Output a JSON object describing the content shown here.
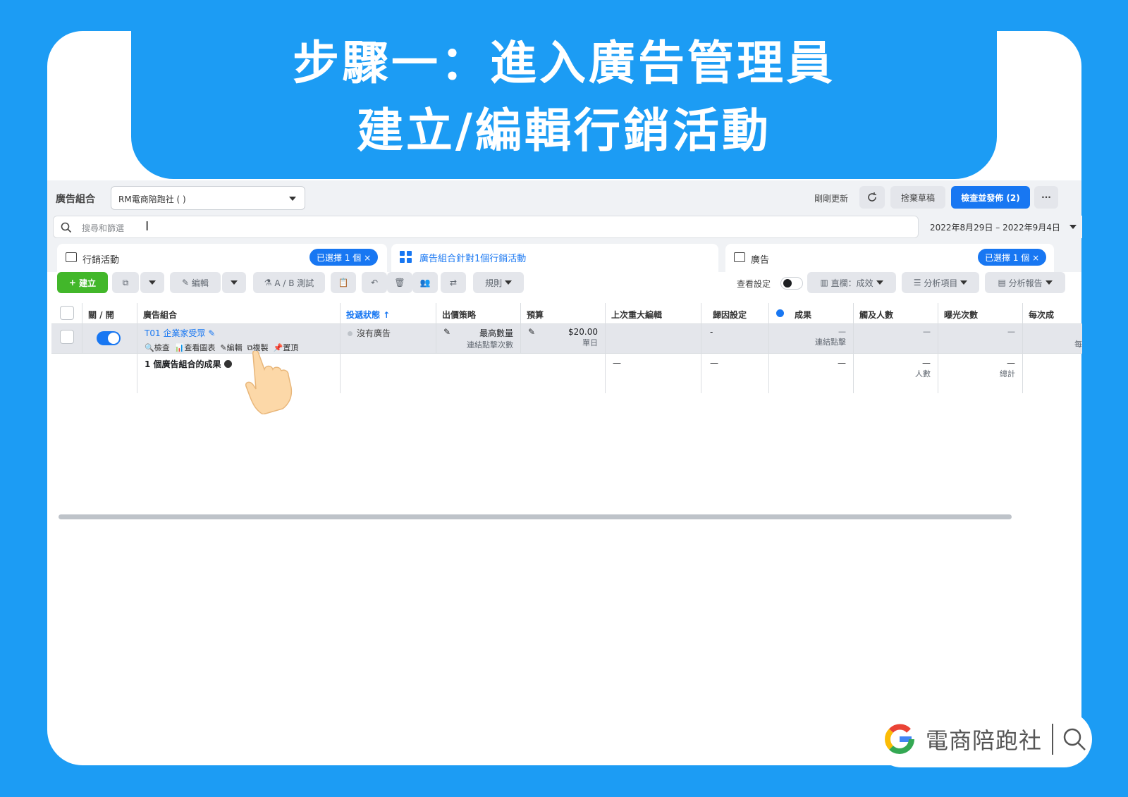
{
  "banner": {
    "line1": "步驟一：進入廣告管理員",
    "line2": "建立/編輯行銷活動"
  },
  "topbar": {
    "section_label": "廣告組合",
    "account_value": "RM電商陪跑社 (                    )",
    "refreshed": "剛剛更新",
    "discard": "捨棄草稿",
    "publish": "檢查並發佈 (2)",
    "more": "···"
  },
  "search": {
    "placeholder": "搜尋和篩選",
    "date_range": "2022年8月29日 – 2022年9月4日"
  },
  "tabs": [
    {
      "label": "行銷活動",
      "chip": "已選擇 1 個"
    },
    {
      "label": "廣告組合針對1個行銷活動"
    },
    {
      "label": "廣告",
      "chip": "已選擇 1 個"
    }
  ],
  "toolbar": {
    "create": "建立",
    "edit": "編輯",
    "ab_test": "A / B 測試",
    "rules": "規則",
    "view_settings": "查看設定",
    "columns": "直欄：成效",
    "breakdown": "分析項目",
    "reports": "分析報告"
  },
  "table": {
    "headers": [
      "關 / 開",
      "廣告組合",
      "投遞狀態 ↑",
      "出價策略",
      "預算",
      "上次重大編輯",
      "歸因設定",
      "成果",
      "觸及人數",
      "曝光次數",
      "每次成"
    ],
    "row": {
      "name": "T01 企業家受眾",
      "actions": [
        "檢查",
        "查看圖表",
        "編輯",
        "複製",
        "置頂"
      ],
      "status": "沒有廣告",
      "bid": "最高數量",
      "bid_sub": "連結點擊次數",
      "budget": "$20.00",
      "budget_sub": "單日",
      "attribution": "-",
      "results": "—",
      "results_sub": "連結點擊",
      "reach": "—",
      "impressions": "—",
      "cost_sub": "每"
    },
    "summary": {
      "label": "1 個廣告組合的成果",
      "last_edit": "—",
      "attribution": "—",
      "results": "—",
      "reach": "—",
      "reach_sub": "人數",
      "impressions": "—",
      "impressions_sub": "總計"
    }
  },
  "brand": {
    "name": "電商陪跑社"
  },
  "colors": {
    "background": "#1c9cf4",
    "primary": "#1877f2",
    "create": "#42b72a"
  }
}
